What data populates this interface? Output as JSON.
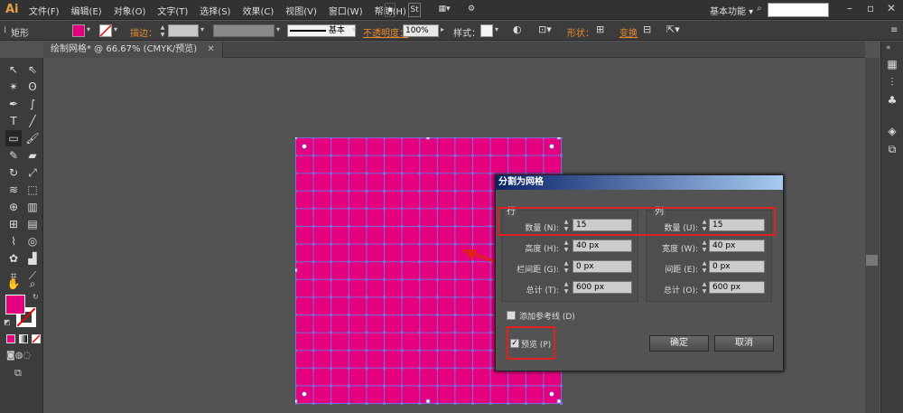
{
  "app": {
    "logo": "Ai"
  },
  "menu": [
    "文件(F)",
    "编辑(E)",
    "对象(O)",
    "文字(T)",
    "选择(S)",
    "效果(C)",
    "视图(V)",
    "窗口(W)",
    "帮助(H)"
  ],
  "menubar": {
    "icon_st": "St",
    "workspace": "基本功能 ▾",
    "search_placeholder": ""
  },
  "control": {
    "tool_name": "矩形",
    "stroke_label": "描边：",
    "basic_label": "基本",
    "opacity_label": "不透明度：",
    "opacity_value": "100%",
    "style_label": "样式：",
    "shape_label": "形状：",
    "transform_label": "变换"
  },
  "document": {
    "tab": "绘制网格* @ 66.67% (CMYK/预览)"
  },
  "colors": {
    "fill": "#e4007f",
    "accent": "#e98b2d",
    "highlight": "#e02020",
    "grid_line": "#7b6bd6"
  },
  "dialog": {
    "title": "分割为网格",
    "rows": {
      "title": "行",
      "count_label": "数量 (N):",
      "count": "15",
      "height_label": "高度 (H):",
      "height": "40 px",
      "gutter_label": "栏间距 (G):",
      "gutter": "0 px",
      "total_label": "总计 (T):",
      "total": "600 px"
    },
    "cols": {
      "title": "列",
      "count_label": "数量 (U):",
      "count": "15",
      "width_label": "宽度 (W):",
      "width": "40 px",
      "gutter_label": "间距 (E):",
      "gutter": "0 px",
      "total_label": "总计 (O):",
      "total": "600 px"
    },
    "add_guides": "添加参考线 (D)",
    "preview": "预览 (P)",
    "ok": "确定",
    "cancel": "取消"
  }
}
